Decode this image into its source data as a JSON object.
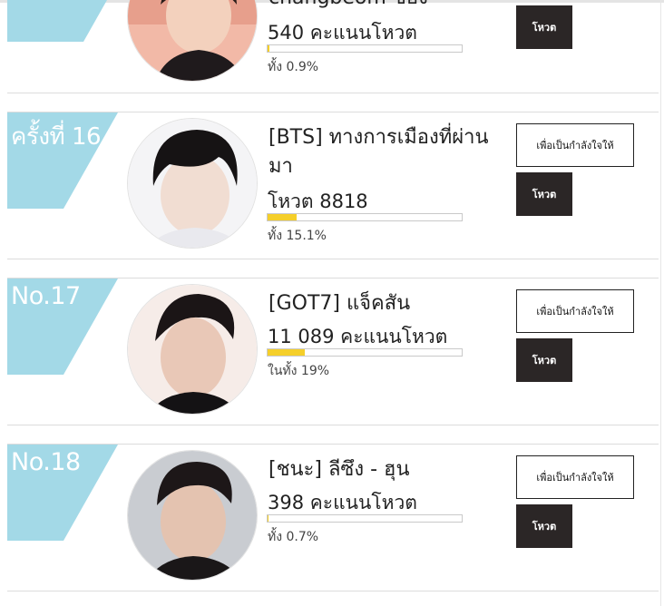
{
  "theme": {
    "rank_color": "#a3d9e7",
    "bar_fill": "#f5cf2a",
    "vote_button_bg": "#2b2626"
  },
  "entries": [
    {
      "name": "changbeom ของ",
      "votes": "540 คะแนนโหวต",
      "progress": 0.009,
      "percent_text": "ทั้ง 0.9%",
      "vote_label": "โหวต"
    },
    {
      "rank": "ครั้งที่ 16",
      "name": "[BTS] ทางการเมืองที่ผ่านมา",
      "votes": "โหวต 8818",
      "progress": 0.151,
      "percent_text": "ทั้ง 15.1%",
      "cheer_label": "เพื่อเป็นกำลังใจให้",
      "vote_label": "โหวต"
    },
    {
      "rank": "No.17",
      "name": "[GOT7] แจ็คสัน",
      "votes": "11 089 คะแนนโหวต",
      "progress": 0.19,
      "percent_text": "ในทั้ง 19%",
      "cheer_label": "เพื่อเป็นกำลังใจให้",
      "vote_label": "โหวต"
    },
    {
      "rank": "No.18",
      "name": "[ชนะ] ลีซึง - ฮุน",
      "votes": "398 คะแนนโหวต",
      "progress": 0.007,
      "percent_text": "ทั้ง 0.7%",
      "cheer_label": "เพื่อเป็นกำลังใจให้",
      "vote_label": "โหวต"
    }
  ]
}
